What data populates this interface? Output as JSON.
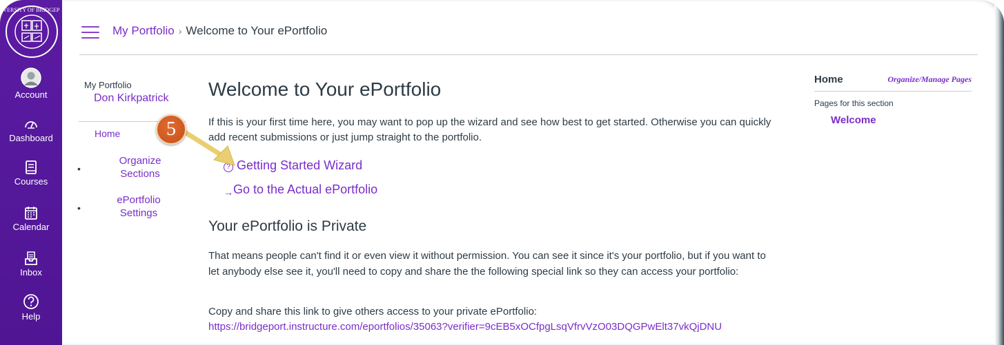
{
  "brand": {
    "nav_color": "#5b1ba3",
    "link_color": "#7a2ec8",
    "callout_color": "#d35f26",
    "logo_text": "UNIVERSITY OF BRIDGEPORT"
  },
  "global_nav": {
    "items": [
      {
        "label": "Account",
        "icon": "avatar-icon"
      },
      {
        "label": "Dashboard",
        "icon": "dashboard-icon"
      },
      {
        "label": "Courses",
        "icon": "courses-icon"
      },
      {
        "label": "Calendar",
        "icon": "calendar-icon"
      },
      {
        "label": "Inbox",
        "icon": "inbox-icon"
      },
      {
        "label": "Help",
        "icon": "help-icon"
      }
    ]
  },
  "breadcrumb": {
    "parent": "My Portfolio",
    "separator": "›",
    "current": "Welcome to Your ePortfolio"
  },
  "section_nav": {
    "label": "My Portfolio",
    "owner": "Don Kirkpatrick",
    "home": "Home",
    "items": [
      "Organize Sections",
      "ePortfolio Settings"
    ],
    "bullet": "•"
  },
  "main": {
    "title": "Welcome to Your ePortfolio",
    "intro": "If this is your first time here, you may want to pop up the wizard and see how best to get started. Otherwise you can quickly add recent submissions or just jump straight to the portfolio.",
    "wizard_icon": "?",
    "wizard_link": "Getting Started Wizard",
    "go_icon": "→",
    "go_link": "Go to the Actual ePortfolio",
    "private_heading": "Your ePortfolio is Private",
    "private_text": "That means people can't find it or even view it without permission. You can see it since it's your portfolio, but if you want to let anybody else see it, you'll need to copy and share the the following special link so they can access your portfolio:",
    "share_text": "Copy and share this link to give others access to your private ePortfolio:",
    "share_link": "https://bridgeport.instructure.com/eportfolios/35063?verifier=9cEB5xOCfpgLsqVfrvVzO03DQGPwElt37vkQjDNU"
  },
  "sidebar": {
    "home": "Home",
    "manage": "Organize/Manage Pages",
    "pages_label": "Pages for this section",
    "page": "Welcome"
  },
  "callout": {
    "step": "5"
  }
}
